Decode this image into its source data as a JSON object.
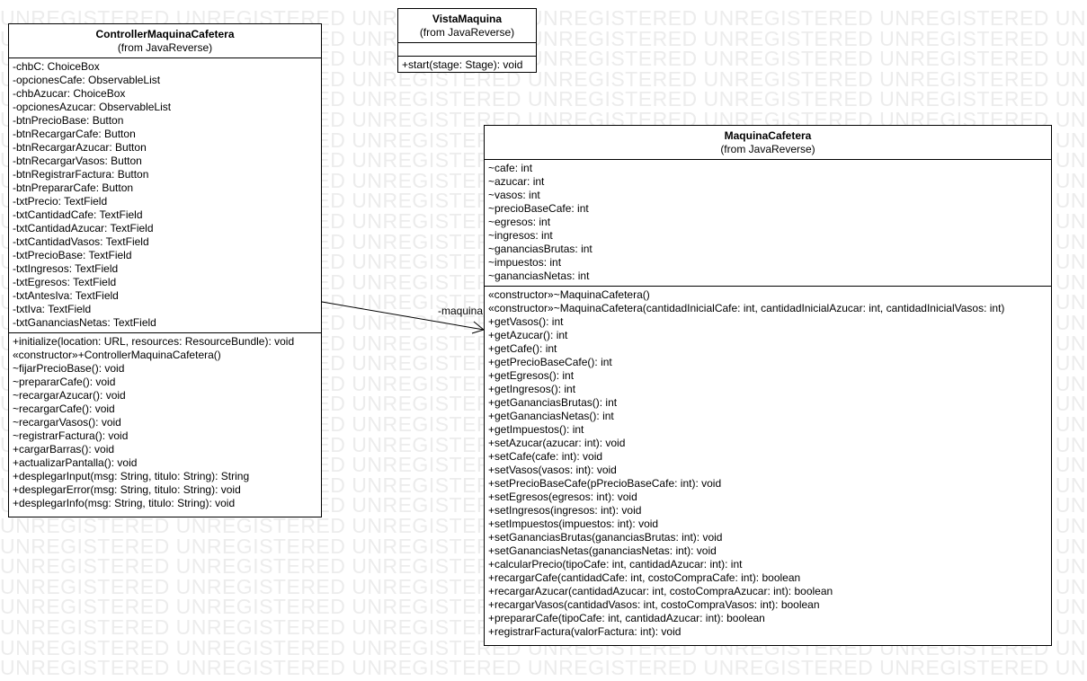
{
  "watermark": {
    "text": "UNREGISTERED UNREGISTERED UNREGISTERED UNREGISTERED UNREGISTERED UNREGISTERED UNREGISTERED"
  },
  "classes": {
    "controller": {
      "name": "ControllerMaquinaCafetera",
      "from": "(from JavaReverse)",
      "attributes": [
        "-chbC: ChoiceBox",
        "-opcionesCafe: ObservableList",
        "-chbAzucar: ChoiceBox",
        "-opcionesAzucar: ObservableList",
        "-btnPrecioBase: Button",
        "-btnRecargarCafe: Button",
        "-btnRecargarAzucar: Button",
        "-btnRecargarVasos: Button",
        "-btnRegistrarFactura: Button",
        "-btnPrepararCafe: Button",
        "-txtPrecio: TextField",
        "-txtCantidadCafe: TextField",
        "-txtCantidadAzucar: TextField",
        "-txtCantidadVasos: TextField",
        "-txtPrecioBase: TextField",
        "-txtIngresos: TextField",
        "-txtEgresos: TextField",
        "-txtAntesIva: TextField",
        "-txtIva: TextField",
        "-txtGananciasNetas: TextField"
      ],
      "operations": [
        "+initialize(location: URL, resources: ResourceBundle): void",
        "«constructor»+ControllerMaquinaCafetera()",
        "~fijarPrecioBase(): void",
        "~prepararCafe(): void",
        "~recargarAzucar(): void",
        "~recargarCafe(): void",
        "~recargarVasos(): void",
        "~registrarFactura(): void",
        "+cargarBarras(): void",
        "+actualizarPantalla(): void",
        "+desplegarInput(msg: String, titulo: String): String",
        "+desplegarError(msg: String, titulo: String): void",
        "+desplegarInfo(msg: String, titulo: String): void"
      ]
    },
    "vista": {
      "name": "VistaMaquina",
      "from": "(from JavaReverse)",
      "attributes": [],
      "operations": [
        "+start(stage: Stage): void"
      ]
    },
    "maquina": {
      "name": "MaquinaCafetera",
      "from": "(from JavaReverse)",
      "attributes": [
        "~cafe: int",
        "~azucar: int",
        "~vasos: int",
        "~precioBaseCafe: int",
        "~egresos: int",
        "~ingresos: int",
        "~gananciasBrutas: int",
        "~impuestos: int",
        "~gananciasNetas: int"
      ],
      "operations": [
        "«constructor»~MaquinaCafetera()",
        "«constructor»~MaquinaCafetera(cantidadInicialCafe: int, cantidadInicialAzucar: int, cantidadInicialVasos: int)",
        "+getVasos(): int",
        "+getAzucar(): int",
        "+getCafe(): int",
        "+getPrecioBaseCafe(): int",
        "+getEgresos(): int",
        "+getIngresos(): int",
        "+getGananciasBrutas(): int",
        "+getGananciasNetas(): int",
        "+getImpuestos(): int",
        "+setAzucar(azucar: int): void",
        "+setCafe(cafe: int): void",
        "+setVasos(vasos: int): void",
        "+setPrecioBaseCafe(pPrecioBaseCafe: int): void",
        "+setEgresos(egresos: int): void",
        "+setIngresos(ingresos: int): void",
        "+setImpuestos(impuestos: int): void",
        "+setGananciasBrutas(gananciasBrutas: int): void",
        "+setGananciasNetas(gananciasNetas: int): void",
        "+calcularPrecio(tipoCafe: int, cantidadAzucar: int): int",
        "+recargarCafe(cantidadCafe: int, costoCompraCafe: int): boolean",
        "+recargarAzucar(cantidadAzucar: int, costoCompraAzucar: int): boolean",
        "+recargarVasos(cantidadVasos: int, costoCompraVasos: int): boolean",
        "+prepararCafe(tipoCafe: int, cantidadAzucar: int): boolean",
        "+registrarFactura(valorFactura: int): void"
      ]
    }
  },
  "association": {
    "role": "-maquina"
  }
}
